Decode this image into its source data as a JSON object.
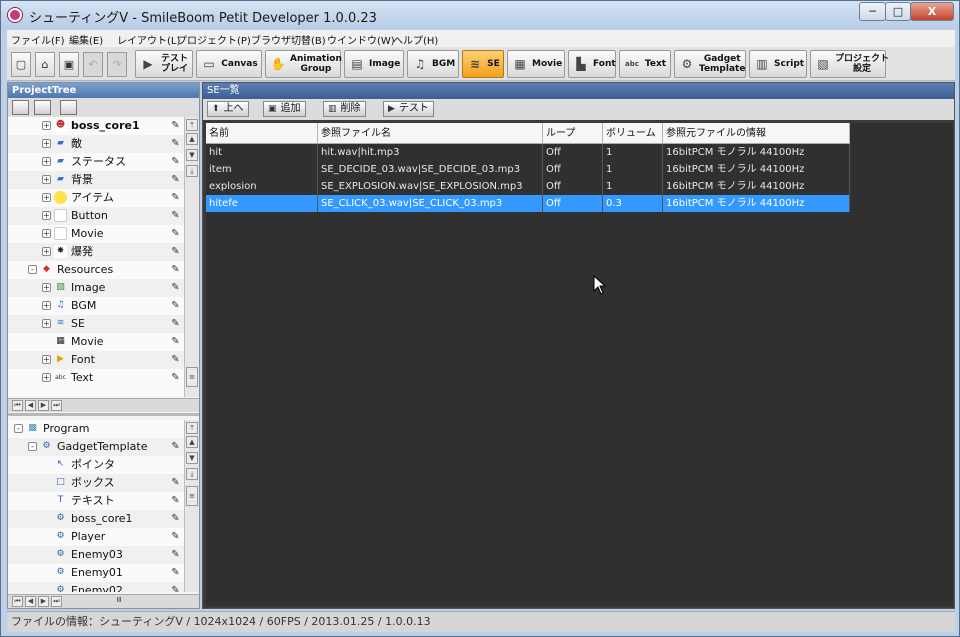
{
  "window": {
    "title": "シューティングV - SmileBoom Petit Developer 1.0.0.23",
    "controls": {
      "minimize": "─",
      "maximize": "□",
      "close": "X"
    }
  },
  "menubar": {
    "items": [
      "ファイル(F)",
      "編集(E)",
      "レイアウト(L)",
      "プロジェクト(P)",
      "ブラウザ切替(B)",
      "ウインドウ(W)",
      "ヘルプ(H)"
    ]
  },
  "toolbar": {
    "small_icons": [
      "new-page-icon",
      "open-folder-icon",
      "save-icon",
      "undo-icon",
      "redo-icon"
    ],
    "buttons": [
      {
        "label": "テスト\nプレイ",
        "icon": "play-icon"
      },
      {
        "label": "Canvas",
        "icon": "canvas-icon"
      },
      {
        "label": "Animation\nGroup",
        "icon": "animation-icon"
      },
      {
        "label": "Image",
        "icon": "image-icon"
      },
      {
        "label": "BGM",
        "icon": "music-icon"
      },
      {
        "label": "SE",
        "icon": "wave-icon",
        "active": true
      },
      {
        "label": "Movie",
        "icon": "movie-icon"
      },
      {
        "label": "Font",
        "icon": "font-icon"
      },
      {
        "label": "Text",
        "icon": "text-icon"
      },
      {
        "label": "Gadget\nTemplate",
        "icon": "gear-icon"
      },
      {
        "label": "Script",
        "icon": "script-icon"
      },
      {
        "label": "プロジェクト\n設定",
        "icon": "project-settings-icon"
      }
    ],
    "accent": "#f3a21b"
  },
  "project_tree": {
    "title": "ProjectTree",
    "rows": [
      {
        "label": "boss_core1",
        "indent": 2,
        "icon": "boss-icon",
        "bold": true,
        "expander": "+"
      },
      {
        "label": "敵",
        "indent": 2,
        "icon": "folder-icon",
        "expander": "+"
      },
      {
        "label": "ステータス",
        "indent": 2,
        "icon": "folder-icon",
        "expander": "+"
      },
      {
        "label": "背景",
        "indent": 2,
        "icon": "folder-icon",
        "expander": "+"
      },
      {
        "label": "アイテム",
        "indent": 2,
        "icon": "item-icon",
        "expander": "+"
      },
      {
        "label": "Button",
        "indent": 2,
        "icon": "blank-icon",
        "expander": "+"
      },
      {
        "label": "Movie",
        "indent": 2,
        "icon": "blank-icon",
        "expander": "+"
      },
      {
        "label": "爆発",
        "indent": 2,
        "icon": "explosion-icon",
        "expander": "+"
      },
      {
        "label": "Resources",
        "indent": 1,
        "icon": "resources-icon",
        "expander": "-"
      },
      {
        "label": "Image",
        "indent": 2,
        "icon": "image-icon",
        "expander": "+"
      },
      {
        "label": "BGM",
        "indent": 2,
        "icon": "music-icon",
        "expander": "+"
      },
      {
        "label": "SE",
        "indent": 2,
        "icon": "wave-icon",
        "expander": "+"
      },
      {
        "label": "Movie",
        "indent": 2,
        "icon": "clapper-icon",
        "expander": ""
      },
      {
        "label": "Font",
        "indent": 2,
        "icon": "font-icon",
        "expander": "+"
      },
      {
        "label": "Text",
        "indent": 2,
        "icon": "abc-icon",
        "expander": "+"
      }
    ]
  },
  "program_tree": {
    "rows": [
      {
        "label": "Program",
        "indent": 0,
        "icon": "program-icon",
        "expander": "-"
      },
      {
        "label": "GadgetTemplate",
        "indent": 1,
        "icon": "gear-icon",
        "expander": "-"
      },
      {
        "label": "ポインタ",
        "indent": 2,
        "icon": "pointer-icon",
        "expander": ""
      },
      {
        "label": "ボックス",
        "indent": 2,
        "icon": "box-icon",
        "expander": ""
      },
      {
        "label": "テキスト",
        "indent": 2,
        "icon": "text-t-icon",
        "expander": ""
      },
      {
        "label": "boss_core1",
        "indent": 2,
        "icon": "gear-icon",
        "expander": ""
      },
      {
        "label": "Player",
        "indent": 2,
        "icon": "gear-icon",
        "expander": ""
      },
      {
        "label": "Enemy03",
        "indent": 2,
        "icon": "gear-icon",
        "expander": ""
      },
      {
        "label": "Enemy01",
        "indent": 2,
        "icon": "gear-icon",
        "expander": ""
      },
      {
        "label": "Enemy02",
        "indent": 2,
        "icon": "gear-icon",
        "expander": ""
      }
    ]
  },
  "se_panel": {
    "title": "SE一覧",
    "buttons": {
      "up": "上へ",
      "add": "追加",
      "delete": "削除",
      "test": "テスト"
    },
    "columns": [
      "名前",
      "参照ファイル名",
      "ループ",
      "ボリューム",
      "参照元ファイルの情報"
    ],
    "rows": [
      [
        "hit",
        "hit.wav|hit.mp3",
        "Off",
        "1",
        "16bitPCM モノラル 44100Hz"
      ],
      [
        "item",
        "SE_DECIDE_03.wav|SE_DECIDE_03.mp3",
        "Off",
        "1",
        "16bitPCM モノラル 44100Hz"
      ],
      [
        "explosion",
        "SE_EXPLOSION.wav|SE_EXPLOSION.mp3",
        "Off",
        "1",
        "16bitPCM モノラル 44100Hz"
      ],
      [
        "hitefe",
        "SE_CLICK_03.wav|SE_CLICK_03.mp3",
        "Off",
        "0.3",
        "16bitPCM モノラル 44100Hz"
      ]
    ],
    "selected_row": 3,
    "selection_color": "#3399ff"
  },
  "statusbar": {
    "text": "ファイルの情報：シューティングV / 1024x1024 / 60FPS / 2013.01.25 / 1.0.0.13"
  }
}
